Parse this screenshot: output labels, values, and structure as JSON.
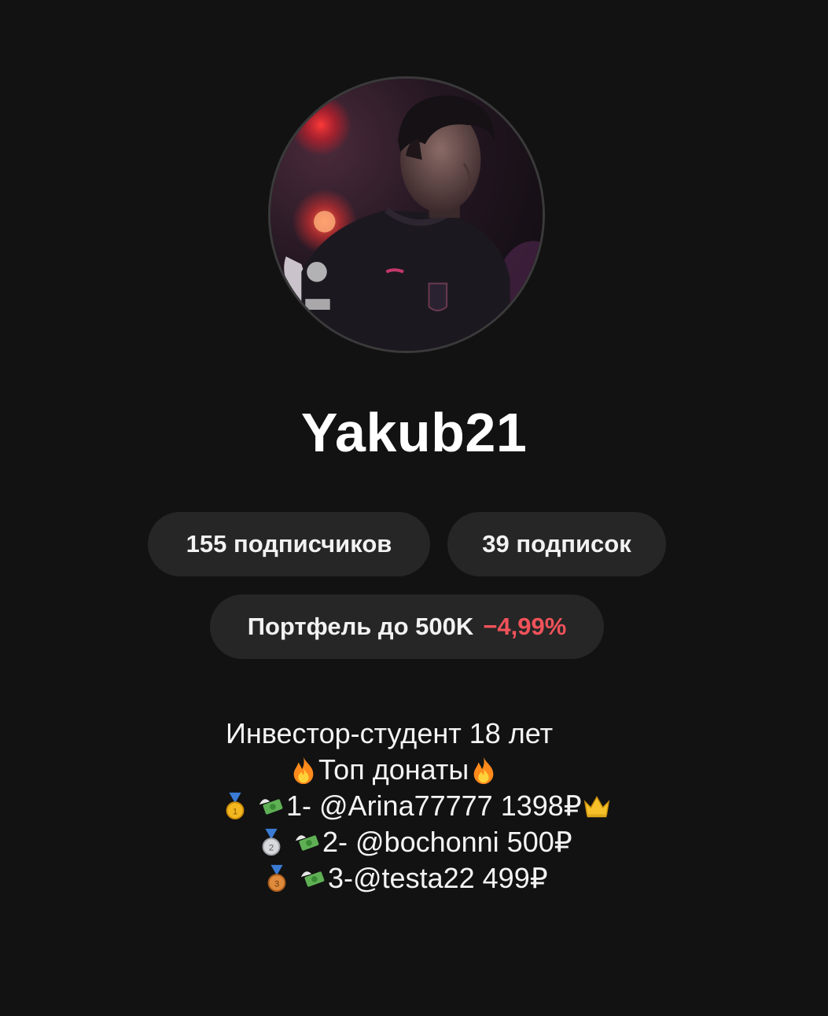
{
  "profile": {
    "username": "Yakub21",
    "followers_label": "155 подписчиков",
    "following_label": "39 подписок",
    "portfolio": {
      "name": "Портфель до 500K",
      "change": "−4,99%",
      "change_color": "#f0525a"
    },
    "bio": {
      "line1": "Инвестор-студент 18 лет",
      "line2": "Топ донаты",
      "donors": [
        {
          "rank_text": "1- @Arina77777 1398₽",
          "medal": "gold-medal-icon",
          "extra": "crown-icon"
        },
        {
          "rank_text": "2- @bochonni 500₽",
          "medal": "silver-medal-icon"
        },
        {
          "rank_text": "3-@testa22 499₽",
          "medal": "bronze-medal-icon"
        }
      ]
    }
  },
  "colors": {
    "background": "#121212",
    "pill": "#262626",
    "text": "#ffffff"
  }
}
